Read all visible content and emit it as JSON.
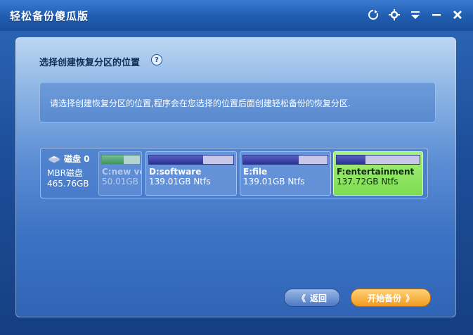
{
  "window": {
    "title": "轻松备份傻瓜版",
    "icons": [
      "refresh-icon",
      "gear-icon",
      "dropdown-menu-icon",
      "minimize-icon",
      "close-icon"
    ]
  },
  "page": {
    "section_title": "选择创建恢复分区的位置",
    "info_text": "请选择创建恢复分区的位置,程序会在您选择的位置后面创建轻松备份的恢复分区."
  },
  "disk": {
    "name": "磁盘 0",
    "type": "MBR磁盘",
    "size": "465.76GB",
    "partitions": [
      {
        "label": "C:new vo",
        "size_text": "50.01GB N",
        "used_pct": 57,
        "state": "disabled"
      },
      {
        "label": "D:software",
        "size_text": "139.01GB Ntfs",
        "used_pct": 64,
        "state": "normal"
      },
      {
        "label": "E:file",
        "size_text": "139.01GB Ntfs",
        "used_pct": 66,
        "state": "normal"
      },
      {
        "label": "F:entertainment",
        "size_text": "137.72GB Ntfs",
        "used_pct": 35,
        "state": "selected"
      }
    ]
  },
  "buttons": {
    "back_label": "返回",
    "start_label": "开始备份"
  },
  "colors": {
    "accent": "#1d4f9a",
    "selected_partition": "#7ddc52",
    "start_button": "#f39a1e"
  }
}
